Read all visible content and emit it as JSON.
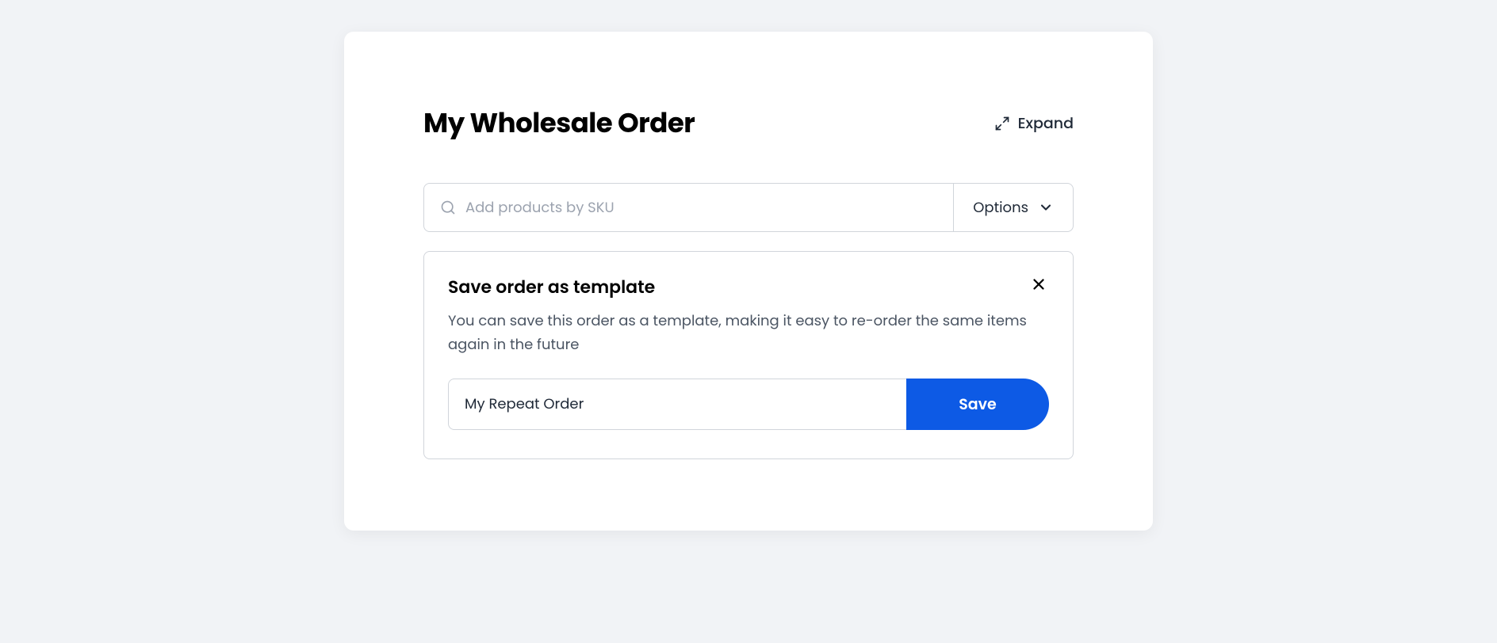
{
  "header": {
    "title": "My Wholesale Order",
    "expand_label": "Expand"
  },
  "search": {
    "placeholder": "Add products by SKU"
  },
  "options": {
    "label": "Options"
  },
  "template_panel": {
    "title": "Save order as template",
    "description": "You can save this order as a template, making it easy to re-order the same items again in the future",
    "input_value": "My Repeat Order",
    "save_label": "Save"
  }
}
